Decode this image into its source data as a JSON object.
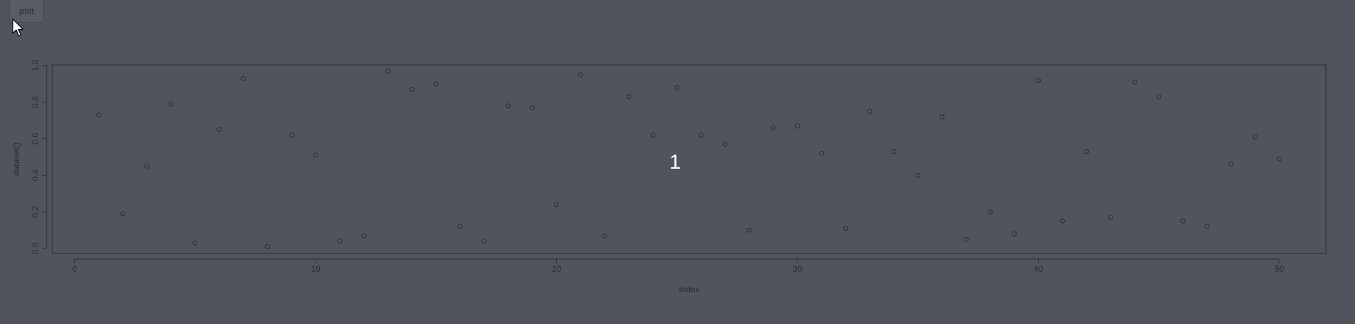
{
  "button": {
    "label": "plot"
  },
  "overlay": {
    "text": "1"
  },
  "colors": {
    "background": "#50545c",
    "ink": "#2a2d31",
    "overlay": "#ffffff"
  },
  "icons": {
    "cursor": "arrow-pointer-icon"
  },
  "chart_data": {
    "type": "scatter",
    "title": "",
    "xlabel": "Index",
    "ylabel": "dataset()",
    "xlim": [
      0,
      52
    ],
    "ylim": [
      0,
      1.03
    ],
    "xticks": [
      0,
      10,
      20,
      30,
      40,
      50
    ],
    "yticks": [
      0.0,
      0.2,
      0.4,
      0.6,
      0.8,
      1.0
    ],
    "xtick_labels": [
      "0",
      "10",
      "20",
      "30",
      "40",
      "50"
    ],
    "ytick_labels": [
      "0.0",
      "0.2",
      "0.4",
      "0.6",
      "0.8",
      "1.0"
    ],
    "grid": false,
    "x": [
      1,
      2,
      3,
      4,
      5,
      6,
      7,
      8,
      9,
      10,
      11,
      12,
      13,
      14,
      15,
      16,
      17,
      18,
      19,
      20,
      21,
      22,
      23,
      24,
      25,
      26,
      27,
      28,
      29,
      30,
      31,
      32,
      33,
      34,
      35,
      36,
      37,
      38,
      39,
      40,
      41,
      42,
      43,
      44,
      45,
      46,
      47,
      48,
      49,
      50
    ],
    "y": [
      0.73,
      0.19,
      0.45,
      0.79,
      0.03,
      0.65,
      0.93,
      0.01,
      0.62,
      0.51,
      0.04,
      0.07,
      0.97,
      0.87,
      0.9,
      0.12,
      0.04,
      0.78,
      0.77,
      0.24,
      0.95,
      0.07,
      0.83,
      0.62,
      0.88,
      0.62,
      0.57,
      0.1,
      0.66,
      0.67,
      0.52,
      0.11,
      0.75,
      0.53,
      0.4,
      0.72,
      0.05,
      0.2,
      0.08,
      0.92,
      0.15,
      0.53,
      0.17,
      0.91,
      0.83,
      0.15,
      0.12,
      0.46,
      0.61,
      0.49
    ]
  }
}
